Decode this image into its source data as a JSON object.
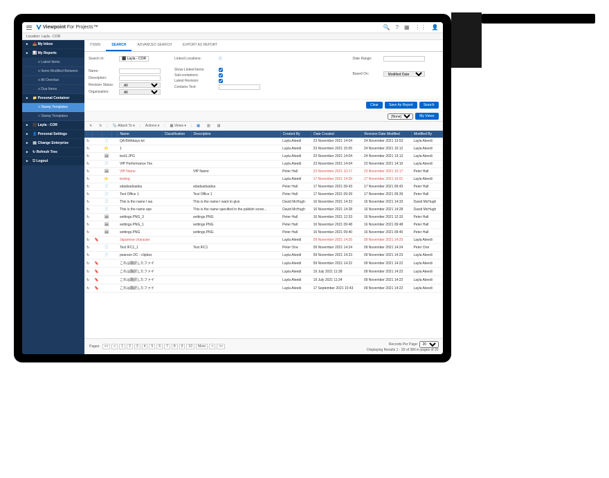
{
  "app": {
    "name_bold": "Viewpoint",
    "name_rest": " For Projects™"
  },
  "breadcrumb": "Location: Layla - COR",
  "topIcons": [
    "search",
    "help",
    "apps",
    "notifications",
    "user"
  ],
  "sidebar": [
    {
      "label": "My Inbox",
      "type": "header",
      "icon": "📥"
    },
    {
      "label": "My Reports",
      "type": "header",
      "icon": "📊"
    },
    {
      "label": "Latest Items",
      "type": "sub",
      "icon": "≡"
    },
    {
      "label": "Items Modified Between",
      "type": "sub",
      "icon": "≡"
    },
    {
      "label": "All Overdue",
      "type": "sub",
      "icon": "≡"
    },
    {
      "label": "Due Items",
      "type": "sub",
      "icon": "≡"
    },
    {
      "label": "Personal Container",
      "type": "header",
      "icon": "📁"
    },
    {
      "label": "Stamp Templates",
      "type": "sub",
      "icon": "□",
      "active": true
    },
    {
      "label": "Stamp Templates",
      "type": "sub",
      "icon": "□"
    },
    {
      "label": "Layla - COR",
      "type": "header",
      "icon": "⬛"
    },
    {
      "label": "Personal Settings",
      "type": "header",
      "icon": "👤"
    },
    {
      "label": "Change Enterprise",
      "type": "header",
      "icon": "🏢"
    },
    {
      "label": "Refresh Tree",
      "type": "header",
      "icon": "↻"
    },
    {
      "label": "Logout",
      "type": "header",
      "icon": "⎋"
    }
  ],
  "tabs": [
    {
      "label": "ITEMS"
    },
    {
      "label": "SEARCH",
      "active": true
    },
    {
      "label": "ADVANCED SEARCH"
    },
    {
      "label": "EXPORT AS REPORT"
    }
  ],
  "form": {
    "searchIn": {
      "label": "Search In:",
      "value": "Layla - COR"
    },
    "name": {
      "label": "Name:"
    },
    "description": {
      "label": "Description:"
    },
    "revisionStatus": {
      "label": "Revision Status:",
      "value": "All"
    },
    "organisation": {
      "label": "Organisation:",
      "value": "All"
    },
    "linkedLocations": {
      "label": "Linked Locations:"
    },
    "showLinked": {
      "label": "Show Linked Items:"
    },
    "subContainers": {
      "label": "Sub-containers:"
    },
    "latestRevision": {
      "label": "Latest Revision:"
    },
    "containsText": {
      "label": "Contains Text:"
    },
    "dateRange": {
      "label": "Date Range:"
    },
    "basedOn": {
      "label": "Based On:",
      "value": "Modified Date"
    }
  },
  "buttons": {
    "clear": "Clear",
    "save": "Save As Report",
    "search": "Search",
    "myViews": "My Views"
  },
  "toolbar": {
    "attachTo": "Attach To",
    "actions": "Actions",
    "views": "Views"
  },
  "viewsDropdown": "[None]",
  "columns": [
    "",
    "",
    "",
    "",
    "Name",
    "Classification",
    "Description",
    "Created By",
    "Date Created",
    "Revision Date Modified",
    "Modified By"
  ],
  "rows": [
    {
      "ic1": "↻",
      "ic2": "",
      "ic3": "📄",
      "name": "QA Birthdays.txt",
      "cls": "",
      "desc": "",
      "by": "Layla Ateedi",
      "dc": "23 November 2021 14:04",
      "rdm": "24 November 2021 13:53",
      "mb": "Layla Ateedi"
    },
    {
      "ic1": "↻",
      "ic2": "",
      "ic3": "📁",
      "name": "1",
      "cls": "",
      "desc": "",
      "by": "Layla Ateedi",
      "dc": "23 November 2021 15:05",
      "rdm": "24 November 2021 10:12",
      "mb": "Layla Ateedi"
    },
    {
      "ic1": "↻",
      "ic2": "",
      "ic3": "🖼",
      "name": "test1.JPG",
      "cls": "",
      "desc": "",
      "by": "Layla Ateedi",
      "dc": "23 November 2021 14:04",
      "rdm": "24 November 2021 13:13",
      "mb": "Layla Ateedi"
    },
    {
      "ic1": "↻",
      "ic2": "",
      "ic3": "📄",
      "name": "VfP Performance Tes",
      "cls": "",
      "desc": "",
      "by": "Layla Ateedi",
      "dc": "23 November 2021 14:04",
      "rdm": "23 November 2021 14:10",
      "mb": "Layla Ateedi"
    },
    {
      "ic1": "↻",
      "ic2": "",
      "ic3": "🖼",
      "name": "VfP Name",
      "cls": "",
      "desc": "VfP Name",
      "by": "Peter Hall",
      "dc": "23 November 2021 10:17",
      "rdm": "23 November 2021 10:17",
      "mb": "Peter Hall",
      "red": true
    },
    {
      "ic1": "↻",
      "ic2": "",
      "ic3": "📁",
      "name": "testing",
      "cls": "",
      "desc": "",
      "by": "Layla Ateedi",
      "dc": "17 November 2021 14:39",
      "rdm": "17 November 2021 15:01",
      "mb": "Layla Ateedi",
      "red": true
    },
    {
      "ic1": "↻",
      "ic2": "",
      "ic3": "📄",
      "name": "sdadsadsadsa",
      "cls": "",
      "desc": "sdadsadsadsa",
      "by": "Peter Hall",
      "dc": "17 November 2021 09:43",
      "rdm": "17 November 2021 09:43",
      "mb": "Peter Hall"
    },
    {
      "ic1": "↻",
      "ic2": "",
      "ic3": "📄",
      "name": "Test Office 1",
      "cls": "",
      "desc": "Test Office 1",
      "by": "Peter Hall",
      "dc": "17 November 2021 09:39",
      "rdm": "17 November 2021 09:39",
      "mb": "Peter Hall"
    },
    {
      "ic1": "↻",
      "ic2": "",
      "ic3": "📄",
      "name": "This is the name I wa",
      "cls": "",
      "desc": "This is the name I want to give",
      "by": "David McHugh",
      "dc": "16 November 2021 14:33",
      "rdm": "16 November 2021 14:33",
      "mb": "David McHugh"
    },
    {
      "ic1": "↻",
      "ic2": "",
      "ic3": "📄",
      "name": "This is the name spe",
      "cls": "",
      "desc": "This is the name specified in the publish scree...",
      "by": "David McHugh",
      "dc": "16 November 2021 14:28",
      "rdm": "16 November 2021 14:28",
      "mb": "David McHugh"
    },
    {
      "ic1": "↻",
      "ic2": "",
      "ic3": "🖼",
      "name": "settings.PNG_3",
      "cls": "",
      "desc": "settings.PNG",
      "by": "Peter Hall",
      "dc": "16 November 2021 12:33",
      "rdm": "16 November 2021 12:33",
      "mb": "Peter Hall"
    },
    {
      "ic1": "↻",
      "ic2": "",
      "ic3": "🖼",
      "name": "settings.PNG_1",
      "cls": "",
      "desc": "settings.PNG",
      "by": "Peter Hall",
      "dc": "16 November 2021 09:48",
      "rdm": "16 November 2021 09:48",
      "mb": "Peter Hall"
    },
    {
      "ic1": "↻",
      "ic2": "",
      "ic3": "🖼",
      "name": "settings.PNG",
      "cls": "",
      "desc": "settings.PNG",
      "by": "Peter Hall",
      "dc": "16 November 2021 09:40",
      "rdm": "16 November 2021 09:40",
      "mb": "Peter Hall"
    },
    {
      "ic1": "↻",
      "ic2": "🔖",
      "ic3": "",
      "name": "Japanese character",
      "cls": "",
      "desc": "",
      "by": "Layla Ateedi",
      "dc": "09 November 2021 14:25",
      "rdm": "09 November 2021 14:25",
      "mb": "Layla Ateedi",
      "red": true
    },
    {
      "ic1": "↻",
      "ic2": "",
      "ic3": "📄",
      "name": "Test IFC1_1",
      "cls": "",
      "desc": "Test IFC1",
      "by": "Peter One",
      "dc": "09 November 2021 14:24",
      "rdm": "09 November 2021 14:24",
      "mb": "Peter One"
    },
    {
      "ic1": "↻",
      "ic2": "",
      "ic3": "📄",
      "name": "pearson DC - clipbox",
      "cls": "",
      "desc": "",
      "by": "Layla Ateedi",
      "dc": "09 November 2021 14:23",
      "rdm": "09 November 2021 14:23",
      "mb": "Layla Ateedi"
    },
    {
      "ic1": "↻",
      "ic2": "🔖",
      "ic3": "",
      "name": "これは翻訳したファイ",
      "cls": "",
      "desc": "",
      "by": "Layla Ateedi",
      "dc": "09 November 2021 14:22",
      "rdm": "09 November 2021 14:22",
      "mb": "Layla Ateedi"
    },
    {
      "ic1": "↻",
      "ic2": "🔖",
      "ic3": "",
      "name": "これは翻訳したファイ",
      "cls": "",
      "desc": "",
      "by": "Layla Ateedi",
      "dc": "19 July 2021 11:38",
      "rdm": "09 November 2021 14:22",
      "mb": "Layla Ateedi"
    },
    {
      "ic1": "↻",
      "ic2": "🔖",
      "ic3": "",
      "name": "これは翻訳したファイ",
      "cls": "",
      "desc": "",
      "by": "Layla Ateedi",
      "dc": "19 July 2021 11:34",
      "rdm": "09 November 2021 14:22",
      "mb": "Layla Ateedi"
    },
    {
      "ic1": "↻",
      "ic2": "🔖",
      "ic3": "",
      "name": "これは翻訳したファイ",
      "cls": "",
      "desc": "",
      "by": "Layla Ateedi",
      "dc": "17 September 2021 10:43",
      "rdm": "09 November 2021 14:22",
      "mb": "Layla Ateedi"
    }
  ],
  "pager": {
    "pagesLabel": "Pages:",
    "nav": [
      "<<",
      "<",
      "1",
      "2",
      "3",
      "4",
      "5",
      "6",
      "7",
      "8",
      "9",
      "10",
      "More",
      ">",
      ">>"
    ],
    "perPage": "Records Per Page:",
    "perPageVal": "20",
    "summary": "Displaying Results 1 - 20 of 380 in pages of 20"
  }
}
